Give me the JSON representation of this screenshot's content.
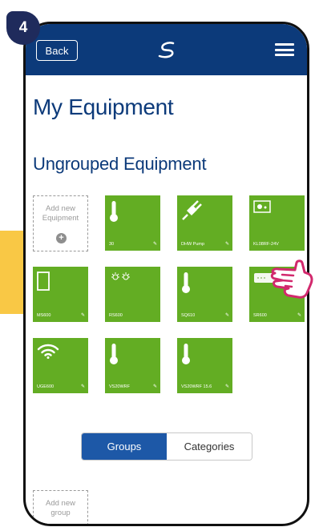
{
  "step_number": "4",
  "header": {
    "back_label": "Back",
    "logo_icon": "salus-logo-icon",
    "menu_icon": "hamburger-menu-icon"
  },
  "page_title": "My Equipment",
  "section_title": "Ungrouped Equipment",
  "add_equipment": {
    "label": "Add new Equipment",
    "icon": "plus-circle-icon"
  },
  "equipment": [
    {
      "label": "30",
      "icon": "thermometer-icon"
    },
    {
      "label": "DHW Pump",
      "icon": "plug-icon"
    },
    {
      "label": "KL08RF-24V",
      "icon": "wiring-center-icon"
    },
    {
      "label": "MS600",
      "icon": "door-sensor-icon"
    },
    {
      "label": "RS600",
      "icon": "lightbulbs-icon"
    },
    {
      "label": "SQ610",
      "icon": "thermometer-icon"
    },
    {
      "label": "SR600",
      "icon": "receiver-icon"
    },
    {
      "label": "UGE600",
      "icon": "wifi-icon"
    },
    {
      "label": "VS20WRF",
      "icon": "thermometer-icon"
    },
    {
      "label": "VS20WRF 15.6",
      "icon": "thermometer-icon"
    }
  ],
  "tabs": {
    "groups_label": "Groups",
    "categories_label": "Categories",
    "active": "Groups"
  },
  "add_group": {
    "label": "Add new group",
    "icon": "plus-circle-icon"
  },
  "colors": {
    "header": "#0c3a7a",
    "tile": "#63ad23",
    "active_tab": "#1d58a7",
    "pointer_arrow": "#f9c845"
  }
}
